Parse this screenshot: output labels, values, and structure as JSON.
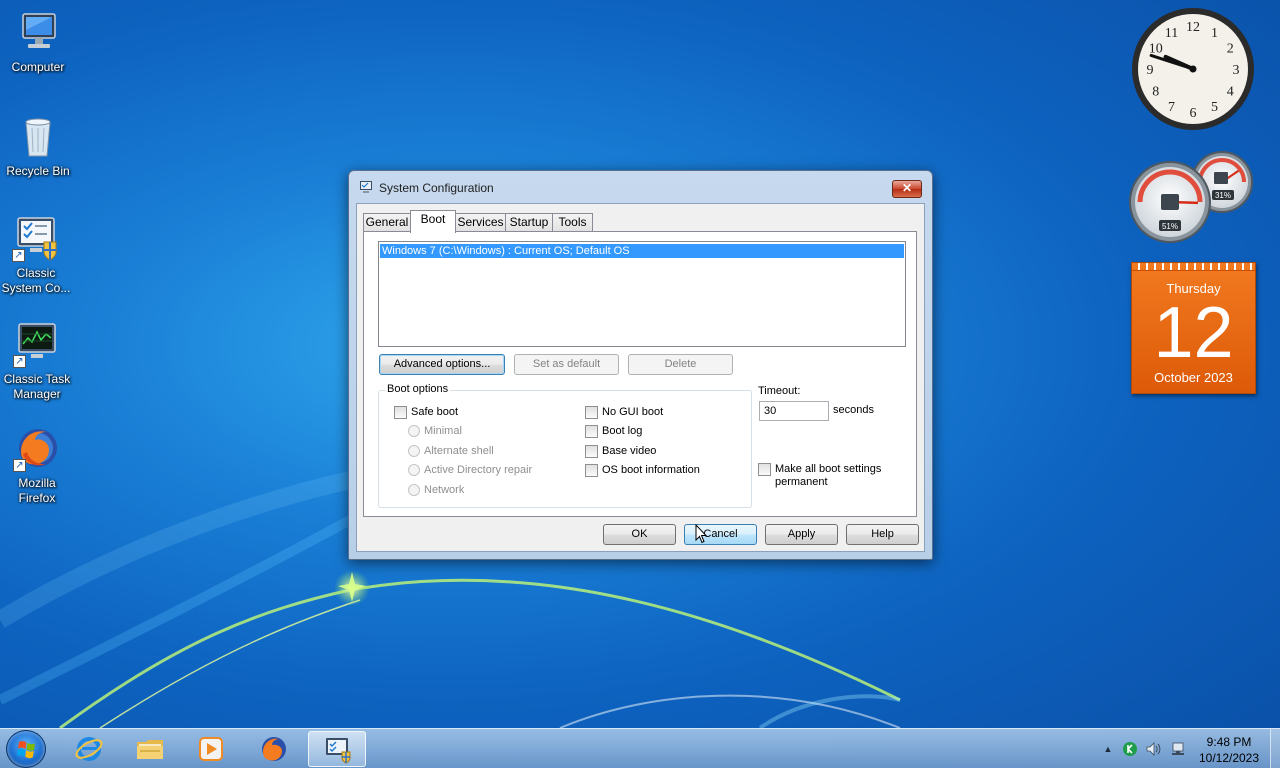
{
  "desktop": {
    "icons": [
      {
        "label": "Computer"
      },
      {
        "label": "Recycle Bin"
      },
      {
        "label": "Classic System Co..."
      },
      {
        "label": "Classic Task Manager"
      },
      {
        "label": "Mozilla Firefox"
      }
    ]
  },
  "gadgets": {
    "clock": {
      "hour": 9,
      "minute": 48,
      "numerals": [
        "12",
        "1",
        "2",
        "3",
        "4",
        "5",
        "6",
        "7",
        "8",
        "9",
        "10",
        "11"
      ]
    },
    "meter": {
      "cpu_label": "51%",
      "memory_label": "31%",
      "cpu_percent": 51,
      "memory_percent": 31
    },
    "calendar": {
      "day_name": "Thursday",
      "day_number": "12",
      "month_year": "October 2023"
    }
  },
  "dialog": {
    "title": "System Configuration",
    "close_glyph": "✕",
    "tabs": [
      "General",
      "Boot",
      "Services",
      "Startup",
      "Tools"
    ],
    "active_tab": "Boot",
    "os_entries": [
      "Windows 7 (C:\\Windows) : Current OS; Default OS"
    ],
    "buttons": {
      "advanced": "Advanced options...",
      "set_default": "Set as default",
      "delete": "Delete"
    },
    "boot_options": {
      "group_label": "Boot options",
      "safe_boot": "Safe boot",
      "minimal": "Minimal",
      "alternate_shell": "Alternate shell",
      "ad_repair": "Active Directory repair",
      "network": "Network",
      "no_gui_boot": "No GUI boot",
      "boot_log": "Boot log",
      "base_video": "Base video",
      "os_boot_info": "OS boot information"
    },
    "timeout": {
      "label": "Timeout:",
      "value": "30",
      "unit": "seconds"
    },
    "make_permanent": "Make all boot settings permanent",
    "footer_buttons": {
      "ok": "OK",
      "cancel": "Cancel",
      "apply": "Apply",
      "help": "Help"
    }
  },
  "taskbar": {
    "time": "9:48 PM",
    "date": "10/12/2023",
    "tray_arrow": "▲"
  },
  "colors": {
    "desktop_blue": "#1a7fd6",
    "selection": "#3399ff",
    "calendar_orange": "#e8650f"
  }
}
